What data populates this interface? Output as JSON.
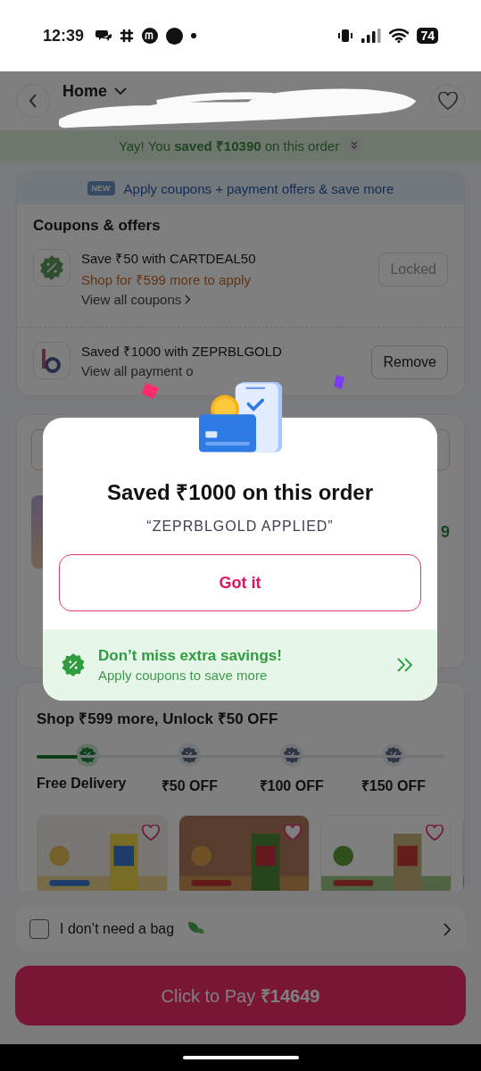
{
  "status_bar": {
    "time": "12:39",
    "battery": "74"
  },
  "header": {
    "title": "Home"
  },
  "savings_banner": {
    "text": "Yay! You **saved ₹10390** on this order"
  },
  "coupons": {
    "promo": {
      "badge": "NEW",
      "text": "Apply coupons + payment offers & save more"
    },
    "title": "Coupons & offers",
    "offers": [
      {
        "kind": "coupon",
        "title": "Save ₹50 with CARTDEAL50",
        "note": "Shop for ₹599 more to apply",
        "link": "View all coupons",
        "action": "Locked",
        "disabled": true
      },
      {
        "kind": "payment",
        "title": "Saved ₹1000 with ZEPRBLGOLD",
        "link": "View all payment o",
        "action": "Remove",
        "disabled": false
      }
    ]
  },
  "hidden_card": {
    "price": "9"
  },
  "unlock": {
    "title": "Shop ₹599 more, Unlock ₹50 OFF",
    "level": 0.1,
    "milestones": [
      {
        "label": "Free Delivery",
        "reached": true
      },
      {
        "label": "₹50 OFF",
        "reached": false
      },
      {
        "label": "₹100 OFF",
        "reached": false
      },
      {
        "label": "₹150 OFF",
        "reached": false
      }
    ],
    "products": [
      {
        "kind": "picture",
        "wishlisted": false
      },
      {
        "kind": "picture",
        "wishlisted": false
      },
      {
        "kind": "picture",
        "wishlisted": false
      },
      {
        "kind": "picture"
      }
    ]
  },
  "bag": {
    "label": "I don’t need a bag",
    "checked": false
  },
  "pay_button": "Click to Pay **₹14649**",
  "modal": {
    "title": "Saved ₹1000 on this order",
    "subtitle": "“ZEPRBLGOLD APPLIED”",
    "button": "Got it",
    "footer": {
      "title": "Don’t miss extra savings!",
      "text": "Apply coupons to save more"
    }
  }
}
